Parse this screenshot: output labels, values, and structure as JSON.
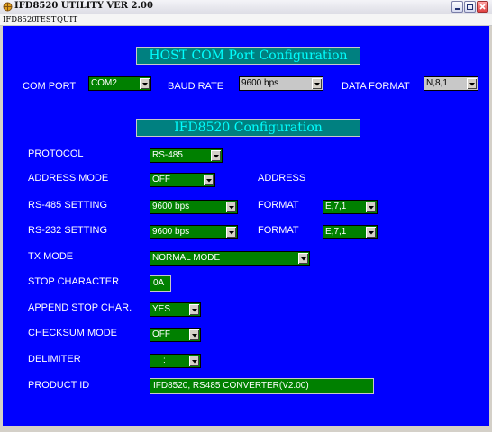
{
  "window": {
    "title": "IFD8520 UTILITY VER 2.00"
  },
  "menu": {
    "items": [
      "IFD8520",
      "TEST",
      "QUIT"
    ]
  },
  "host": {
    "header": "HOST COM Port Configuration",
    "com_port": {
      "label": "COM PORT",
      "value": "COM2"
    },
    "baud_rate": {
      "label": "BAUD RATE",
      "value": "9600 bps"
    },
    "data_format": {
      "label": "DATA FORMAT",
      "value": "N,8,1"
    }
  },
  "ifd": {
    "header": "IFD8520 Configuration",
    "protocol": {
      "label": "PROTOCOL",
      "value": "RS-485"
    },
    "address_mode": {
      "label": "ADDRESS MODE",
      "value": "OFF",
      "address_label": "ADDRESS"
    },
    "rs485": {
      "label": "RS-485 SETTING",
      "value": "9600 bps",
      "format_label": "FORMAT",
      "format": "E,7,1"
    },
    "rs232": {
      "label": "RS-232 SETTING",
      "value": "9600 bps",
      "format_label": "FORMAT",
      "format": "E,7,1"
    },
    "tx_mode": {
      "label": "TX MODE",
      "value": "NORMAL MODE"
    },
    "stop_char": {
      "label": "STOP CHARACTER",
      "value": "0A"
    },
    "append_stop": {
      "label": "APPEND STOP CHAR.",
      "value": "YES"
    },
    "checksum": {
      "label": "CHECKSUM MODE",
      "value": "OFF"
    },
    "delimiter": {
      "label": "DELIMITER",
      "value": ":"
    },
    "product_id": {
      "label": "PRODUCT ID",
      "value": "IFD8520, RS485 CONVERTER(V2.00)"
    }
  }
}
